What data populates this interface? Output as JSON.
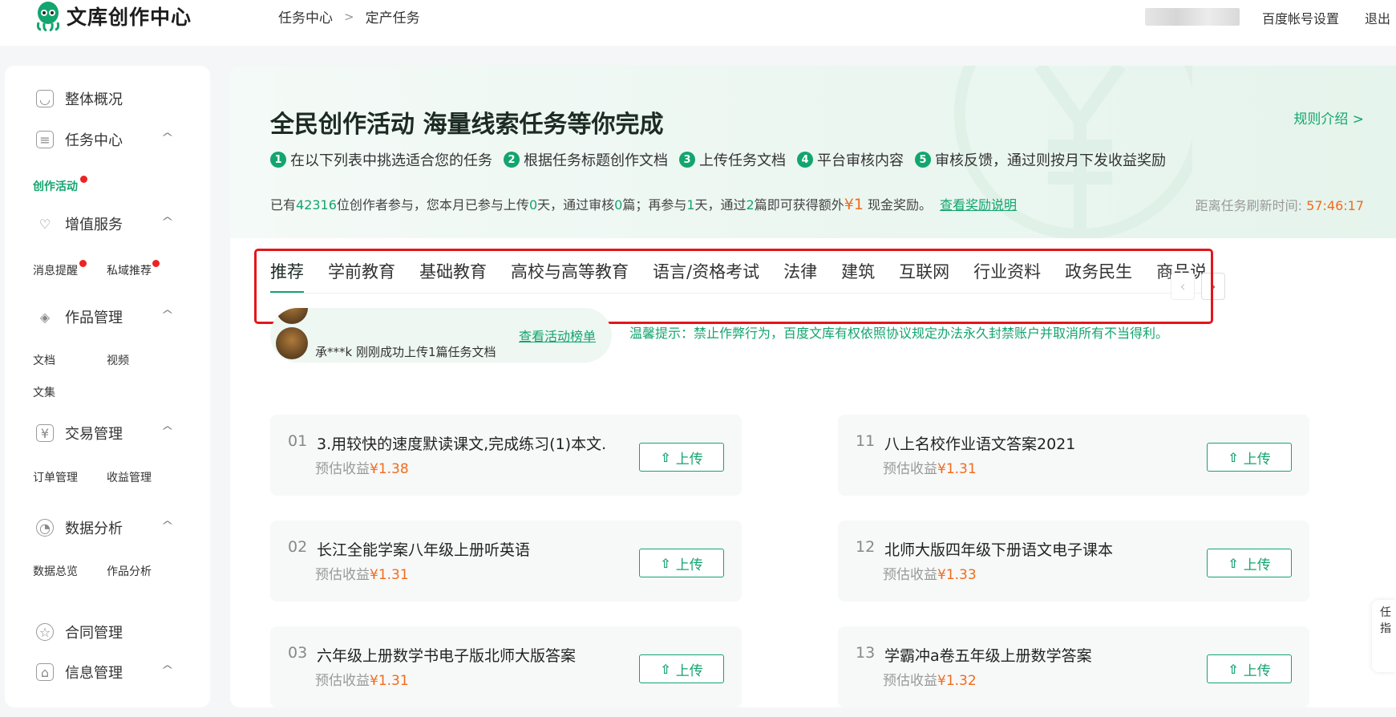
{
  "header": {
    "logo_text": "文库创作中心",
    "breadcrumb": [
      "任务中心",
      "定产任务"
    ],
    "account_settings": "百度帐号设置",
    "logout": "退出"
  },
  "sidebar": {
    "items": [
      {
        "label": "整体概况",
        "icon": "dashboard-icon"
      },
      {
        "label": "任务中心",
        "icon": "task-icon"
      },
      {
        "label": "增值服务",
        "icon": "heart-icon"
      },
      {
        "label": "作品管理",
        "icon": "layers-icon"
      },
      {
        "label": "交易管理",
        "icon": "yuan-icon"
      },
      {
        "label": "数据分析",
        "icon": "pie-chart-icon"
      },
      {
        "label": "合同管理",
        "icon": "contract-icon"
      },
      {
        "label": "信息管理",
        "icon": "inbox-icon"
      }
    ],
    "subs": {
      "task": [
        "创作活动"
      ],
      "service": [
        "消息提醒",
        "私域推荐"
      ],
      "works": [
        "文档",
        "视频",
        "文集"
      ],
      "trade": [
        "订单管理",
        "收益管理"
      ],
      "data": [
        "数据总览",
        "作品分析"
      ]
    }
  },
  "hero": {
    "title": "全民创作活动 海量线索任务等你完成",
    "rules_link": "规则介绍 >",
    "steps": [
      {
        "num": "1",
        "text": "在以下列表中挑选适合您的任务"
      },
      {
        "num": "2",
        "text": "根据任务标题创作文档"
      },
      {
        "num": "3",
        "text": "上传任务文档"
      },
      {
        "num": "4",
        "text": "平台审核内容"
      },
      {
        "num": "5",
        "text": "审核反馈，通过则按月下发收益奖励"
      }
    ],
    "stats": {
      "p1": "已有",
      "creators": "42316",
      "p2": "位创作者参与，您本月已参与上传",
      "days": "0",
      "p3": "天，通过审核",
      "passed": "0",
      "p4": "篇；再参与",
      "more_days": "1",
      "p5": "天，通过",
      "more_docs": "2",
      "p6": "篇即可获得额外",
      "reward": "¥1",
      "p7": "现金奖励。",
      "link": "查看奖励说明"
    },
    "countdown_label": "距离任务刷新时间: ",
    "countdown": "57:46:17"
  },
  "tabs": [
    "推荐",
    "学前教育",
    "基础教育",
    "高校与高等教育",
    "语言/资格考试",
    "法律",
    "建筑",
    "互联网",
    "行业资料",
    "政务民生",
    "商品说明书"
  ],
  "ticker": {
    "items": [
      "承***k 刚刚成功上传1篇任务文档"
    ],
    "link": "查看活动榜单"
  },
  "tip": "温馨提示：禁止作弊行为，百度文库有权依照协议规定办法永久封禁账户并取消所有不当得利。",
  "cards": [
    {
      "no": "01",
      "title": "3.用较快的速度默读课文,完成练习(1)本文...",
      "earn_label": "预估收益",
      "price": "¥1.38",
      "btn": "上传"
    },
    {
      "no": "11",
      "title": "八上名校作业语文答案2021",
      "earn_label": "预估收益",
      "price": "¥1.31",
      "btn": "上传"
    },
    {
      "no": "02",
      "title": "长江全能学案八年级上册听英语",
      "earn_label": "预估收益",
      "price": "¥1.31",
      "btn": "上传"
    },
    {
      "no": "12",
      "title": "北师大版四年级下册语文电子课本",
      "earn_label": "预估收益",
      "price": "¥1.33",
      "btn": "上传"
    },
    {
      "no": "03",
      "title": "六年级上册数学书电子版北师大版答案",
      "earn_label": "预估收益",
      "price": "¥1.31",
      "btn": "上传"
    },
    {
      "no": "13",
      "title": "学霸冲a卷五年级上册数学答案",
      "earn_label": "预估收益",
      "price": "¥1.32",
      "btn": "上传"
    }
  ],
  "float_text": "任指",
  "colors": {
    "accent": "#13a56e",
    "price": "#f26b1d",
    "highlight_box": "#e3161b"
  }
}
